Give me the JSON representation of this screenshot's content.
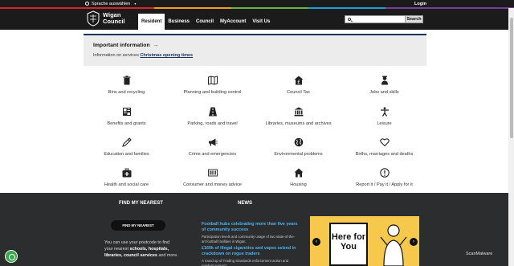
{
  "topbar": {
    "language_label": "Sprache auswählen",
    "login_label": "Login"
  },
  "header": {
    "logo_line1": "Wigan",
    "logo_line2": "Council",
    "nav": [
      {
        "label": "Resident"
      },
      {
        "label": "Business"
      },
      {
        "label": "Council"
      },
      {
        "label": "MyAccount"
      },
      {
        "label": "Visit Us"
      }
    ],
    "search_button": "Search",
    "search_value": ""
  },
  "important": {
    "title": "Important information",
    "arrow": "→",
    "line_prefix": "Information on services",
    "link": "Christmas opening times"
  },
  "services": [
    {
      "label": "Bins and recycling",
      "icon": "bin-icon"
    },
    {
      "label": "Planning and building control",
      "icon": "map-icon"
    },
    {
      "label": "Council Tax",
      "icon": "house-pound-icon"
    },
    {
      "label": "Jobs and skills",
      "icon": "worker-icon"
    },
    {
      "label": "Benefits and grants",
      "icon": "calculator-icon"
    },
    {
      "label": "Parking, roads and travel",
      "icon": "road-icon"
    },
    {
      "label": "Libraries, museums and archives",
      "icon": "museum-icon"
    },
    {
      "label": "Leisure",
      "icon": "person-active-icon"
    },
    {
      "label": "Education and families",
      "icon": "pencil-icon"
    },
    {
      "label": "Crime and emergencies",
      "icon": "megaphone-icon"
    },
    {
      "label": "Environmental problems",
      "icon": "globe-icon"
    },
    {
      "label": "Births, marriages and deaths",
      "icon": "heart-icon"
    },
    {
      "label": "Health and social care",
      "icon": "medical-bag-icon"
    },
    {
      "label": "Consumer and money advice",
      "icon": "barcode-icon"
    },
    {
      "label": "Housing",
      "icon": "house-icon"
    },
    {
      "label": "Report it / Pay it / Apply for it",
      "icon": "alert-icon"
    }
  ],
  "find_nearest": {
    "title": "FIND MY NEAREST",
    "button": "FIND MY NEAREST",
    "text_prefix": "You can use your postcode to find your nearest",
    "text_bold": "schools, hospitals, libraries, council services",
    "text_suffix": "and more."
  },
  "news": {
    "title": "NEWS",
    "items": [
      {
        "headline": "Football hubs celebrating more than five years of community success",
        "summary": "Participation levels and community usage of two state-of-the-art football facilities in Wigan."
      },
      {
        "headline": "£160k of illegal cigarettes and vapes seized in crackdown on rogue traders",
        "summary": "A round up of Trading Standards enforcement action and resident support."
      }
    ]
  },
  "promo": {
    "line1": "Here for",
    "line2": "You"
  },
  "watermark": "ScanMalware",
  "colors": {
    "header_bg": "#1b1b1b",
    "accent_navy": "#17325f",
    "news_link": "#4db3f0",
    "promo_yellow": "#f6c94d"
  }
}
